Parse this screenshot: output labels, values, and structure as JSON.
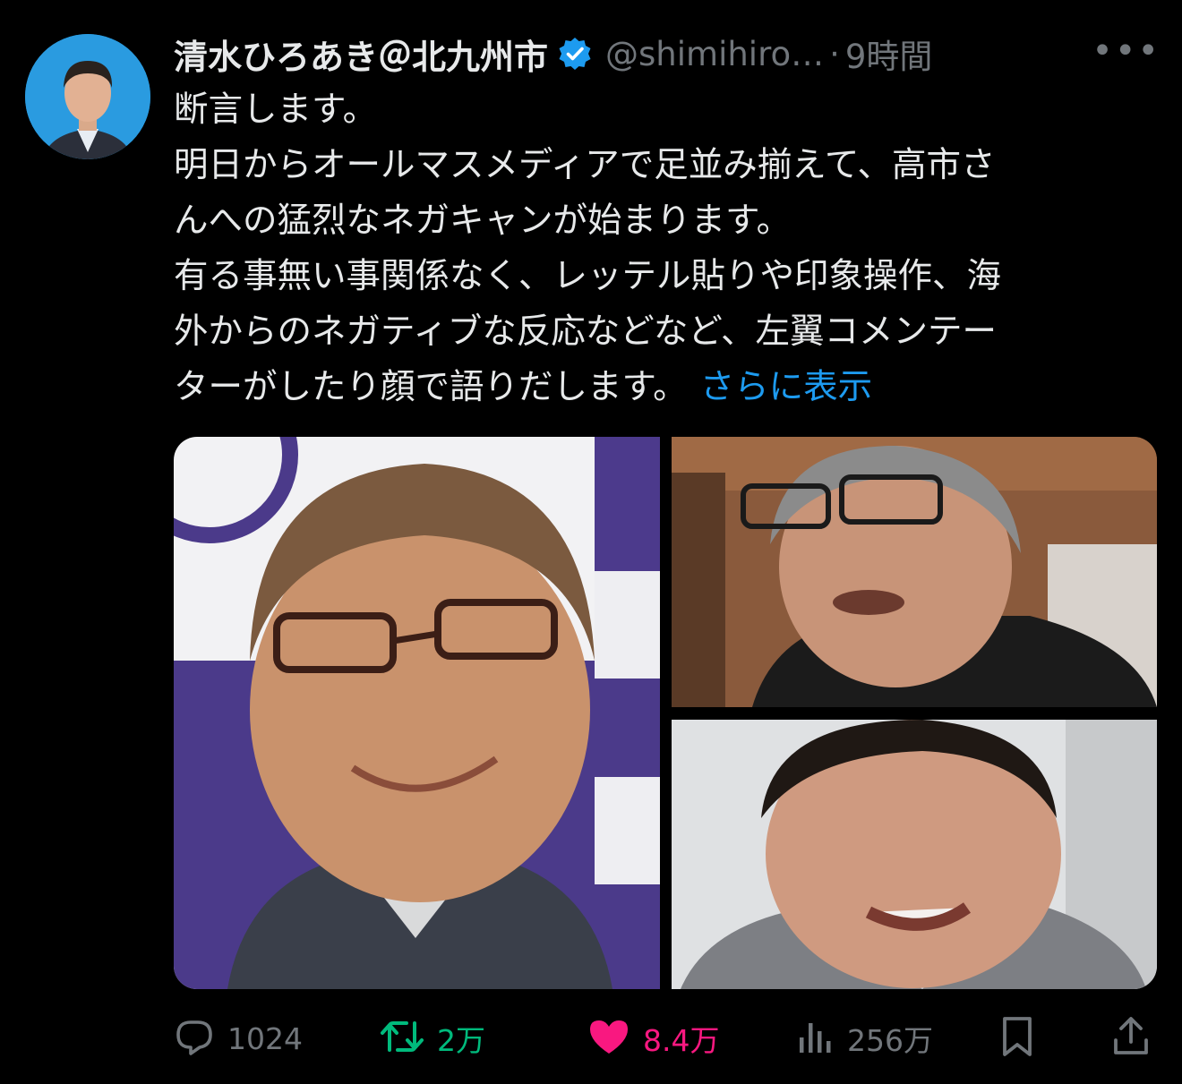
{
  "post": {
    "author": {
      "display_name": "清水ひろあき＠北九州市",
      "handle": "@shimihiro…",
      "verified": true,
      "avatar_icon": "user-avatar"
    },
    "separator": "·",
    "time": "9時間",
    "more_icon": "more-dots-icon",
    "text_lines": [
      "断言します。",
      "明日からオールマスメディアで足並み揃えて、高市さ",
      "んへの猛烈なネガキャンが始まります。",
      "有る事無い事関係なく、レッテル貼りや印象操作、海",
      "外からのネガティブな反応などなど、左翼コメンテー",
      "ターがしたり顔で語りだします。"
    ],
    "show_more": "さらに表示",
    "media": [
      {
        "icon": "photo-older-man-glasses-smiling"
      },
      {
        "icon": "photo-man-glasses-gray-hair"
      },
      {
        "icon": "photo-man-speaking"
      }
    ]
  },
  "actions": {
    "reply": {
      "icon": "reply-icon",
      "count": "1024"
    },
    "retweet": {
      "icon": "retweet-icon",
      "count": "2万"
    },
    "like": {
      "icon": "heart-filled-icon",
      "count": "8.4万"
    },
    "views": {
      "icon": "views-chart-icon",
      "count": "256万"
    },
    "bookmark": {
      "icon": "bookmark-icon"
    },
    "share": {
      "icon": "share-icon"
    }
  },
  "colors": {
    "background": "#000000",
    "text": "#e7e9ea",
    "secondary": "#71767b",
    "link": "#1d9bf0",
    "retweet": "#00ba7c",
    "like": "#f91880",
    "verified": "#1d9bf0"
  }
}
